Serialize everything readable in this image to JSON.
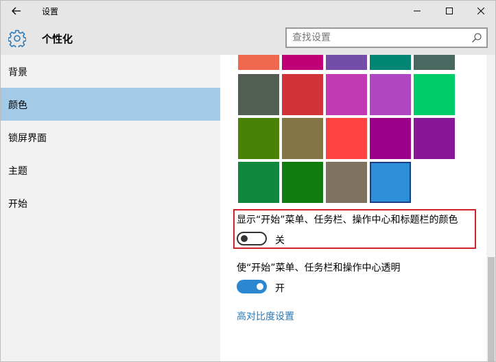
{
  "titlebar": {
    "app_title": "设置",
    "icons": {
      "back": "back-arrow-icon",
      "minimize": "minimize-icon",
      "maximize": "maximize-icon",
      "close": "close-icon"
    }
  },
  "header": {
    "page_title": "个性化",
    "page_icon": "gear-icon",
    "search_placeholder": "查找设置",
    "search_value": "",
    "search_icon": "search-icon"
  },
  "sidebar": {
    "items": [
      {
        "label": "背景",
        "active": false
      },
      {
        "label": "颜色",
        "active": true
      },
      {
        "label": "锁屏界面",
        "active": false
      },
      {
        "label": "主题",
        "active": false
      },
      {
        "label": "开始",
        "active": false
      }
    ]
  },
  "palette": {
    "rows": [
      [
        "#ef6950",
        "#bf0077",
        "#744da9",
        "#018574",
        "#486860"
      ],
      [
        "#525e54",
        "#d13438",
        "#c239b3",
        "#b146c2",
        "#00cc6a"
      ],
      [
        "#498205",
        "#847545",
        "#ff4343",
        "#9a0089",
        "#881798"
      ],
      [
        "#10893e",
        "#107c10",
        "#7e735f",
        "#2d8fd5"
      ]
    ],
    "selected": "#2d8fd5"
  },
  "settings": {
    "show_color": {
      "label": "显示“开始”菜单、任务栏、操作中心和标题栏的颜色",
      "state_label": "关",
      "on": false
    },
    "transparency": {
      "label": "使“开始”菜单、任务栏和操作中心透明",
      "state_label": "开",
      "on": true
    },
    "high_contrast_link": "高对比度设置"
  },
  "colors": {
    "accent": "#2a87d0",
    "sidebar_active": "#a3cae6",
    "highlight_border": "#d0202a",
    "link": "#2a7ab7"
  }
}
